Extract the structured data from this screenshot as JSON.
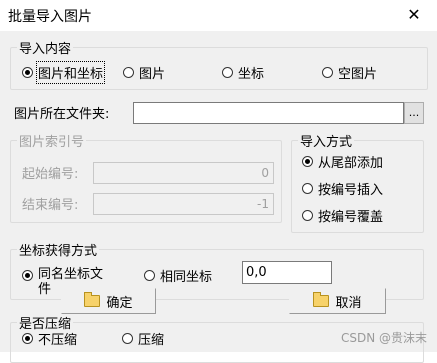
{
  "window": {
    "title": "批量导入图片",
    "close_glyph": "✕"
  },
  "import_content": {
    "legend": "导入内容",
    "options": [
      "图片和坐标",
      "图片",
      "坐标",
      "空图片"
    ],
    "selected": 0
  },
  "folder": {
    "label": "图片所在文件夹:",
    "value": "",
    "browse": "..."
  },
  "index": {
    "legend": "图片索引号",
    "start_label": "起始编号:",
    "start_value": "0",
    "end_label": "结束编号:",
    "end_value": "-1"
  },
  "import_mode": {
    "legend": "导入方式",
    "options": [
      "从尾部添加",
      "按编号插入",
      "按编号覆盖"
    ],
    "selected": 0
  },
  "coord": {
    "legend": "坐标获得方式",
    "options": [
      "同名坐标文件",
      "相同坐标"
    ],
    "selected": 0,
    "value": "0,0"
  },
  "buttons": {
    "ok": "确定",
    "cancel": "取消"
  },
  "compress": {
    "legend": "是否压缩",
    "options": [
      "不压缩",
      "压缩"
    ],
    "selected": 0
  },
  "watermark": "CSDN @贵沫末"
}
